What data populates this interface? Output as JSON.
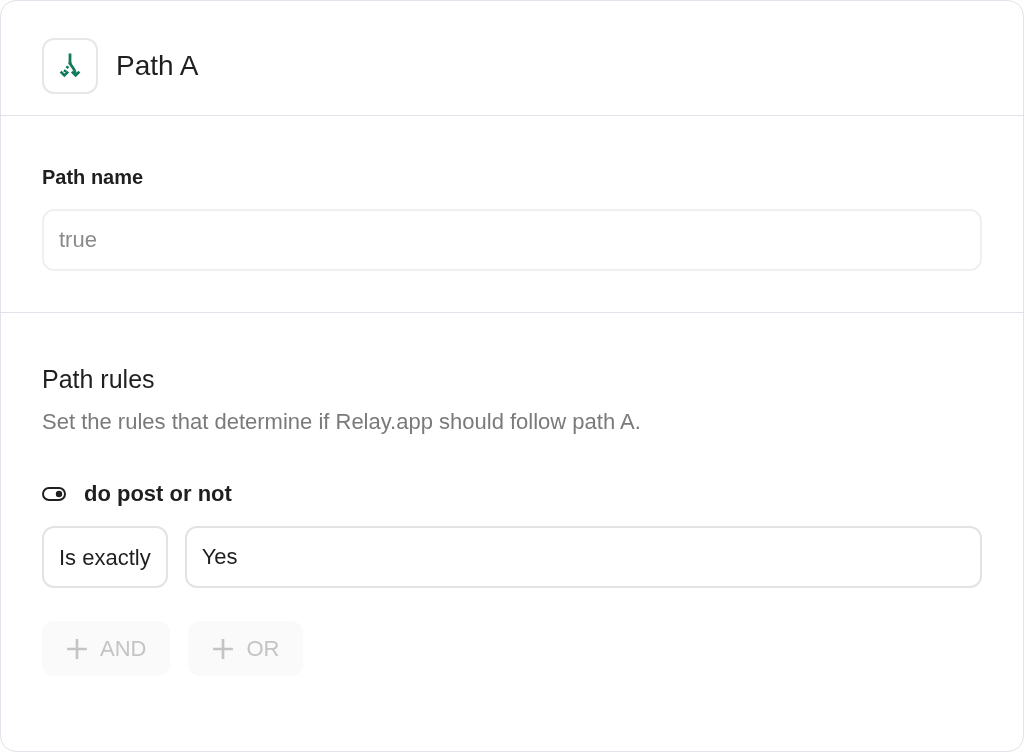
{
  "header": {
    "title": "Path A"
  },
  "path_name": {
    "label": "Path name",
    "placeholder": "true"
  },
  "path_rules": {
    "title": "Path rules",
    "description": "Set the rules that determine if Relay.app should follow path A.",
    "rules": [
      {
        "field": "do post or not",
        "operator": "Is exactly",
        "value": "Yes"
      }
    ],
    "buttons": [
      {
        "label": "AND",
        "disabled": true
      },
      {
        "label": "OR",
        "disabled": true
      }
    ]
  }
}
